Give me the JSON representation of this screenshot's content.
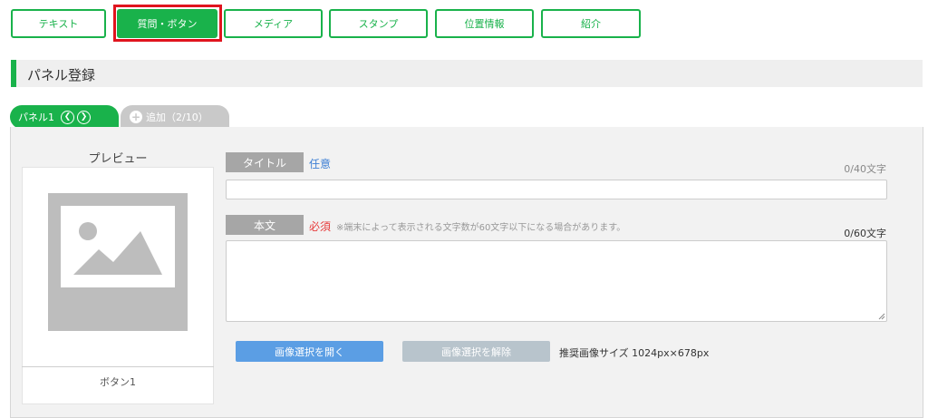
{
  "tabs": [
    {
      "label": "テキスト",
      "active": false
    },
    {
      "label": "質問・ボタン",
      "active": true
    },
    {
      "label": "メディア",
      "active": false
    },
    {
      "label": "スタンプ",
      "active": false
    },
    {
      "label": "位置情報",
      "active": false
    },
    {
      "label": "紹介",
      "active": false
    }
  ],
  "section": {
    "title": "パネル登録"
  },
  "panel_tabs": {
    "current": "パネル1",
    "add_label": "追加（2/10）"
  },
  "preview": {
    "label": "プレビュー",
    "caption": "ボタン1"
  },
  "form": {
    "title_label": "タイトル",
    "title_note": "任意",
    "title_counter": "0/40文字",
    "title_value": "",
    "body_label": "本文",
    "body_note": "必須",
    "body_hint": "※端末によって表示される文字数が60文字以下になる場合があります。",
    "body_counter": "0/60文字",
    "body_value": ""
  },
  "buttons": {
    "open_image": "画像選択を開く",
    "clear_image": "画像選択を解除",
    "size_note": "推奨画像サイズ 1024px×678px"
  },
  "colors": {
    "accent": "#19b24b",
    "highlight": "#e0141e",
    "primary_button": "#5b9ee4",
    "disabled_button": "#b8c4cc",
    "required": "#e73c3c",
    "optional": "#3d7fd4"
  }
}
